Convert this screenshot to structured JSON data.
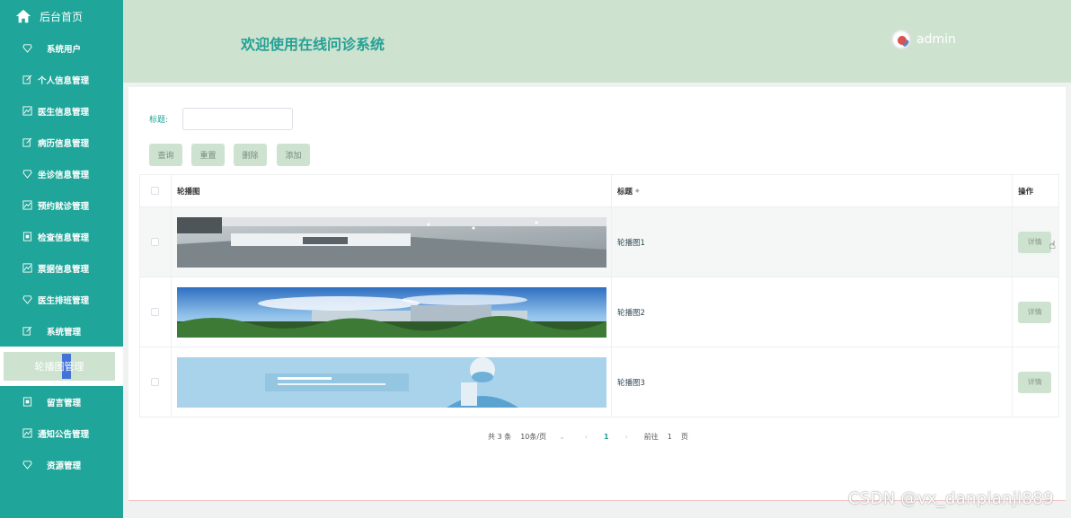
{
  "sidebar": {
    "home_label": "后台首页",
    "items": [
      {
        "label": "系统用户"
      },
      {
        "label": "个人信息管理"
      },
      {
        "label": "医生信息管理"
      },
      {
        "label": "病历信息管理"
      },
      {
        "label": "坐诊信息管理"
      },
      {
        "label": "预约就诊管理"
      },
      {
        "label": "检查信息管理"
      },
      {
        "label": "票据信息管理"
      },
      {
        "label": "医生排班管理"
      },
      {
        "label": "系统管理"
      },
      {
        "label": "轮播图管理"
      },
      {
        "label": "留言管理"
      },
      {
        "label": "通知公告管理"
      },
      {
        "label": "资源管理"
      }
    ],
    "active_index": 10,
    "bg_color": "#1fa599"
  },
  "header": {
    "title": "欢迎使用在线问诊系统",
    "username": "admin",
    "bg_color": "#cde3d0"
  },
  "search": {
    "label": "标题:",
    "value": ""
  },
  "buttons": {
    "query": "查询",
    "reset": "重置",
    "delete": "删除",
    "add": "添加"
  },
  "table": {
    "columns": {
      "image": "轮播图",
      "title": "标题",
      "actions": "操作"
    },
    "rows": [
      {
        "title": "轮播图1",
        "action": "详情",
        "image_icon": "hospital-corridor-photo"
      },
      {
        "title": "轮播图2",
        "action": "详情",
        "image_icon": "hospital-building-photo"
      },
      {
        "title": "轮播图3",
        "action": "详情",
        "image_icon": "doctor-banner-photo"
      }
    ]
  },
  "pagination": {
    "total": "共 3 条",
    "page_size": "10条/页",
    "current_page": "1",
    "goto_prefix": "前往",
    "goto_value": "1",
    "goto_suffix": "页"
  },
  "watermark": "CSDN @vx_danpianji889"
}
